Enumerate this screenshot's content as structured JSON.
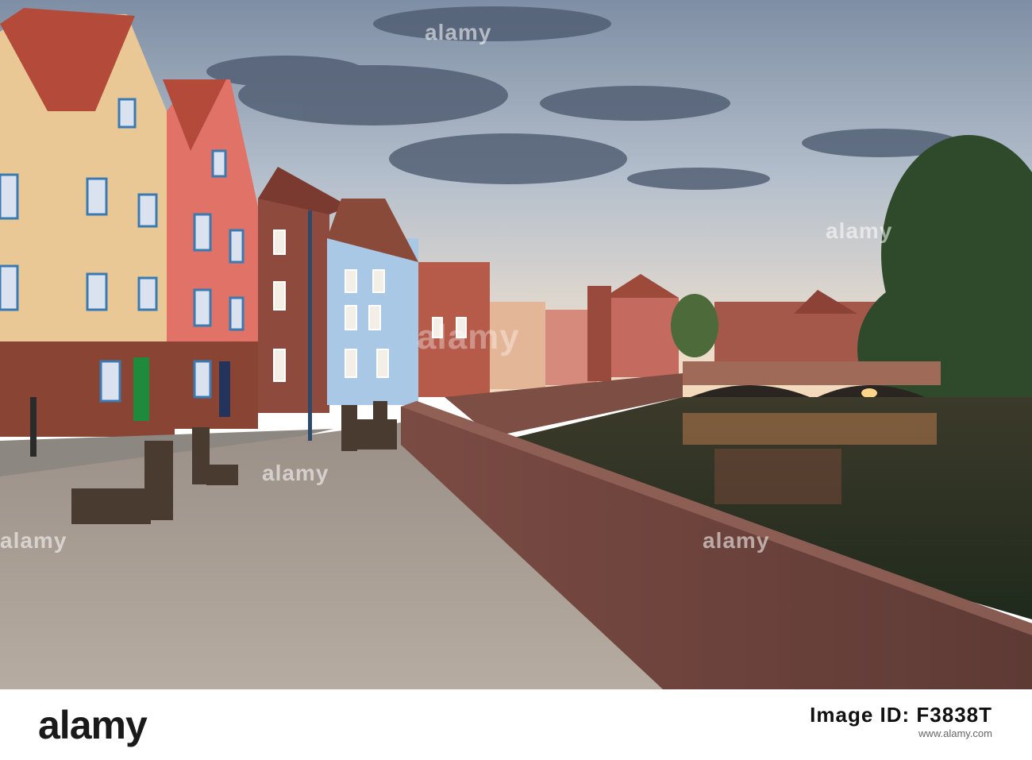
{
  "photo": {
    "description_tag": "riverside-street-at-dusk"
  },
  "watermarks": [
    "alamy",
    "alamy",
    "alamy",
    "alamy",
    "alamy",
    "alamy"
  ],
  "footer": {
    "logo": "alamy",
    "ident_label": "Image ID: F3838T",
    "ident_site": "www.alamy.com"
  },
  "colors": {
    "sky_top": "#7f8ea3",
    "sky_horizon": "#f2dcc4",
    "brick": "#8a4a3c",
    "water": "#2b3320"
  }
}
